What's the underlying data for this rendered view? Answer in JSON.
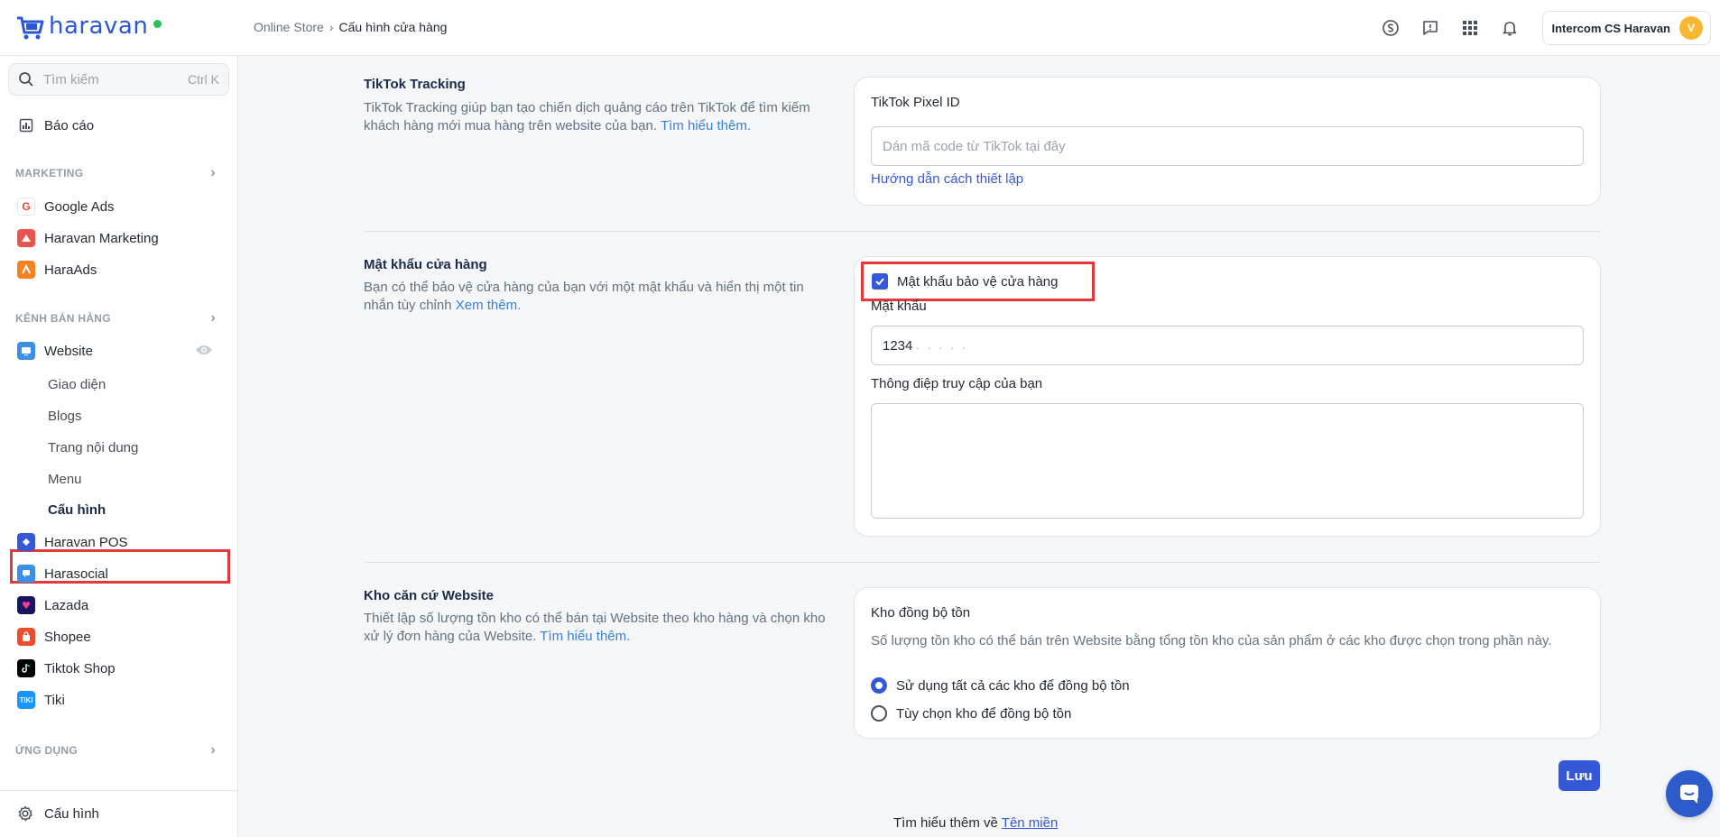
{
  "app": {
    "logo_text": "haravan"
  },
  "breadcrumb": {
    "parent": "Online Store",
    "current": "Cấu hình cửa hàng"
  },
  "account": {
    "name": "Intercom CS Haravan",
    "avatar_letter": "V"
  },
  "sidebar": {
    "search_placeholder": "Tìm kiếm",
    "search_shortcut": "Ctrl K",
    "report": "Báo cáo",
    "marketing_head": "MARKETING",
    "marketing_items": [
      "Google Ads",
      "Haravan Marketing",
      "HaraAds"
    ],
    "channels_head": "KÊNH BÁN HÀNG",
    "website": "Website",
    "website_sub": [
      "Giao diện",
      "Blogs",
      "Trang nội dung",
      "Menu",
      "Cấu hình"
    ],
    "channels": [
      "Haravan POS",
      "Harasocial",
      "Lazada",
      "Shopee",
      "Tiktok Shop",
      "Tiki"
    ],
    "apps_head": "ỨNG DỤNG",
    "settings": "Cấu hình"
  },
  "tiktok": {
    "title": "TikTok Tracking",
    "desc": "TikTok Tracking giúp bạn tạo chiến dịch quảng cáo trên TikTok để tìm kiếm khách hàng mới mua hàng trên website của bạn.",
    "link": "Tìm hiểu thêm.",
    "field_label": "TikTok Pixel ID",
    "field_placeholder": "Dán mã code từ TikTok tại đây",
    "guide_link": "Hướng dẫn cách thiết lập"
  },
  "password": {
    "title": "Mật khẩu cửa hàng",
    "desc": "Bạn có thể bảo vệ cửa hàng của bạn với một mật khẩu và hiển thị một tin nhắn tùy chỉnh",
    "link": "Xem thêm.",
    "checkbox_label": "Mật khẩu bảo vệ cửa hàng",
    "checked": true,
    "password_label": "Mật khẩu",
    "password_value": "1234",
    "message_label": "Thông điệp truy cập của bạn"
  },
  "warehouse": {
    "title": "Kho căn cứ Website",
    "desc": "Thiết lập số lượng tồn kho có thể bán tại Website theo kho hàng và chọn kho xử lý đơn hàng của Website.",
    "link": "Tìm hiểu thêm.",
    "card_title": "Kho đồng bộ tồn",
    "card_desc": "Số lượng tồn kho có thể bán trên Website bằng tổng tồn kho của sản phẩm ở các kho được chọn trong phần này.",
    "option_all": "Sử dụng tất cả các kho để đồng bộ tồn",
    "option_custom": "Tùy chọn kho để đồng bộ tồn",
    "selected": "all"
  },
  "actions": {
    "save": "Lưu"
  },
  "footer": {
    "text": "Tìm hiểu thêm về",
    "link": "Tên miền"
  },
  "colors": {
    "primary": "#3558d8",
    "highlight": "#e23a3a",
    "link": "#3b82d6"
  }
}
